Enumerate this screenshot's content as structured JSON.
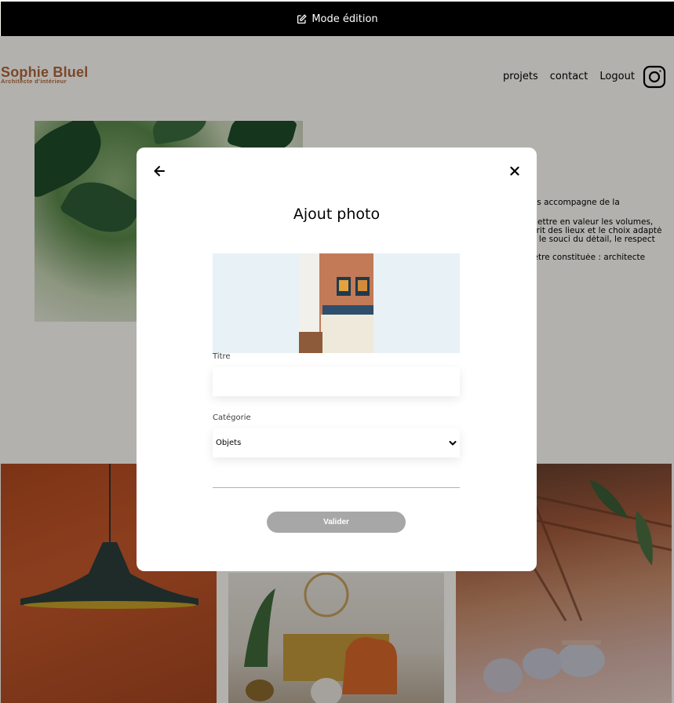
{
  "edit_bar": {
    "label": "Mode édition",
    "icon": "pen-square-icon"
  },
  "header": {
    "logo_title": "Sophie Bluel",
    "logo_subtitle": "Architecte d'intérieur",
    "nav": [
      "projets",
      "contact",
      "Logout"
    ],
    "instagram_icon": "instagram-icon"
  },
  "intro": {
    "lines": [
      "vous accompagne de la",
      "à mettre en valeur les volumes,",
      "esprit des lieux et le choix adapté",
      "ans le souci du détail, le respect",
      "ut-être constituée : architecte"
    ]
  },
  "modal": {
    "title": "Ajout photo",
    "back_icon": "arrow-left-icon",
    "close_icon": "close-icon",
    "title_label": "Titre",
    "title_value": "",
    "category_label": "Catégorie",
    "category_value": "Objets",
    "validate_label": "Valider"
  },
  "colors": {
    "accent": "#b1663c",
    "button_disabled": "#a7a7a7",
    "upload_bg": "#e8f1f6"
  }
}
